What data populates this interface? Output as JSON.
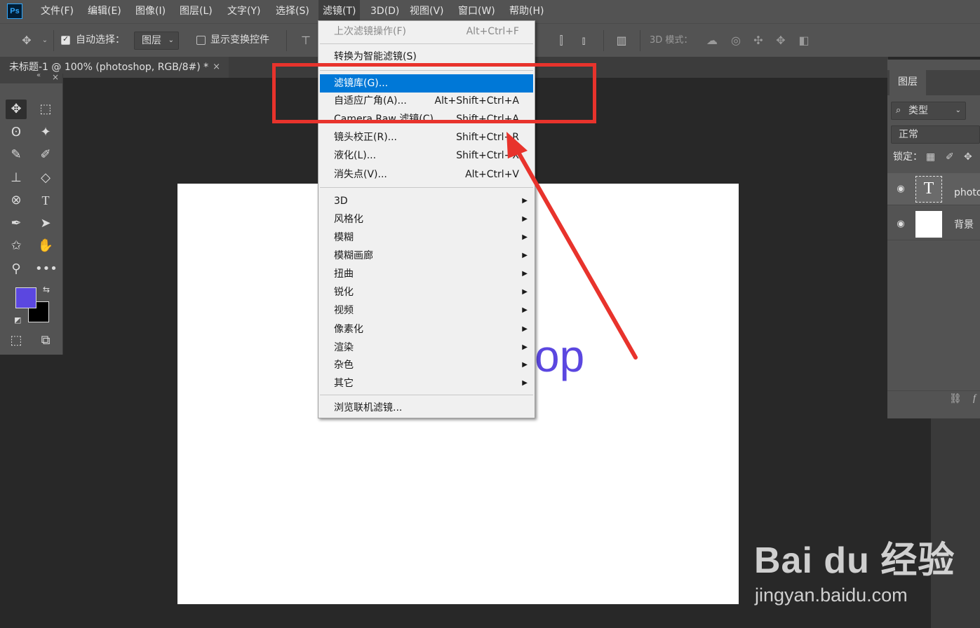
{
  "menubar": {
    "logo": "Ps",
    "items": [
      "文件(F)",
      "编辑(E)",
      "图像(I)",
      "图层(L)",
      "文字(Y)",
      "选择(S)",
      "滤镜(T)",
      "3D(D)",
      "视图(V)",
      "窗口(W)",
      "帮助(H)"
    ],
    "active": "滤镜(T)"
  },
  "options": {
    "auto_select_label": "自动选择：",
    "auto_select_checked": true,
    "layer_select_value": "图层",
    "show_transform_label": "显示变换控件",
    "show_transform_checked": false,
    "mode_3d_label": "3D 模式："
  },
  "document": {
    "tab_title": "未标题-1 @ 100% (photoshop, RGB/8#) *",
    "close": "×",
    "canvas_text_visible": "op",
    "text_color": "#5b47e0"
  },
  "filter_menu": {
    "last_filter": {
      "label": "上次滤镜操作(F)",
      "shortcut": "Alt+Ctrl+F"
    },
    "convert_smart": {
      "label": "转换为智能滤镜(S)"
    },
    "filter_gallery": {
      "label": "滤镜库(G)..."
    },
    "adaptive_wide": {
      "label": "自适应广角(A)...",
      "shortcut": "Alt+Shift+Ctrl+A"
    },
    "camera_raw": {
      "label": "Camera Raw 滤镜(C)...",
      "shortcut": "Shift+Ctrl+A"
    },
    "lens_correction": {
      "label": "镜头校正(R)...",
      "shortcut": "Shift+Ctrl+R"
    },
    "liquify": {
      "label": "液化(L)...",
      "shortcut": "Shift+Ctrl+X"
    },
    "vanishing_point": {
      "label": "消失点(V)...",
      "shortcut": "Alt+Ctrl+V"
    },
    "submenus": [
      "3D",
      "风格化",
      "模糊",
      "模糊画廊",
      "扭曲",
      "锐化",
      "视频",
      "像素化",
      "渲染",
      "杂色",
      "其它"
    ],
    "browse_online": {
      "label": "浏览联机滤镜..."
    }
  },
  "layers_panel": {
    "tab": "图层",
    "filter_type": "类型",
    "blend_mode": "正常",
    "lock_label": "锁定：",
    "layers": [
      {
        "name": "photo",
        "kind": "text",
        "thumb_glyph": "T"
      },
      {
        "name": "背景",
        "kind": "background"
      }
    ]
  },
  "colors": {
    "foreground": "#5b47e0",
    "background": "#000000",
    "highlight": "#0078d7",
    "annotation": "#e8332c"
  },
  "watermark": {
    "logo": "Bai du 经验",
    "url": "jingyan.baidu.com"
  }
}
